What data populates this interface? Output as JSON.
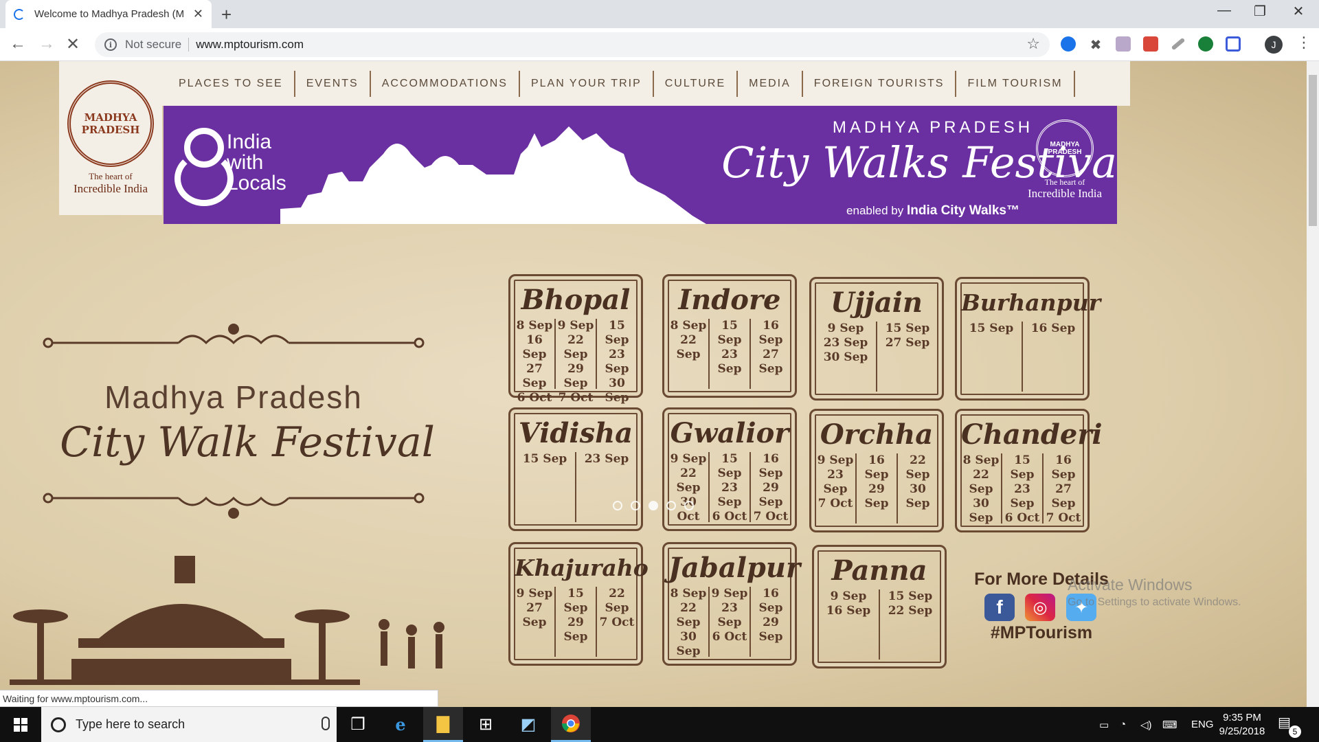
{
  "browser": {
    "tab_title": "Welcome to Madhya Pradesh (M",
    "security_label": "Not secure",
    "url": "www.mptourism.com",
    "profile_initial": "J",
    "status_text": "Waiting for www.mptourism.com..."
  },
  "site": {
    "logo": {
      "seal_text": "MADHYA PRADESH",
      "tagline_top": "The heart of",
      "tagline_bottom": "Incredible India"
    },
    "nav": [
      "PLACES TO SEE",
      "EVENTS",
      "ACCOMMODATIONS",
      "PLAN YOUR TRIP",
      "CULTURE",
      "MEDIA",
      "FOREIGN TOURISTS",
      "FILM TOURISM"
    ],
    "banner": {
      "brand_line1": "India",
      "brand_line2": "with",
      "brand_line3": "Locals",
      "state": "MADHYA PRADESH",
      "title": "City Walks Festival",
      "sub_prefix": "enabled by",
      "sub_brand": "India City Walks™",
      "seal_tag1": "The heart of",
      "seal_tag2": "Incredible India",
      "color": "#6a2fa0"
    },
    "poster": {
      "state": "Madhya Pradesh",
      "title": "City Walk Festival",
      "more_title": "For More Details",
      "hashtag": "#MPTourism",
      "social": [
        "facebook-icon",
        "instagram-icon",
        "twitter-icon"
      ]
    },
    "cities": [
      {
        "name": "Bhopal",
        "cols": [
          [
            "8 Sep",
            "16 Sep",
            "27 Sep",
            "6 Oct"
          ],
          [
            "9 Sep",
            "22 Sep",
            "29 Sep",
            "7 Oct"
          ],
          [
            "15 Sep",
            "23 Sep",
            "30 Sep"
          ]
        ]
      },
      {
        "name": "Indore",
        "cols": [
          [
            "8 Sep",
            "22 Sep"
          ],
          [
            "15 Sep",
            "23 Sep"
          ],
          [
            "16 Sep",
            "27 Sep"
          ]
        ]
      },
      {
        "name": "Ujjain",
        "cols": [
          [
            "9 Sep",
            "23 Sep",
            "30 Sep"
          ],
          [
            "15 Sep",
            "27 Sep"
          ]
        ]
      },
      {
        "name": "Burhanpur",
        "cols": [
          [
            "15 Sep"
          ],
          [
            "16 Sep"
          ]
        ]
      },
      {
        "name": "Vidisha",
        "cols": [
          [
            "15 Sep"
          ],
          [
            "23 Sep"
          ]
        ]
      },
      {
        "name": "Gwalior",
        "cols": [
          [
            "9 Sep",
            "22 Sep",
            "30 Oct"
          ],
          [
            "15 Sep",
            "23 Sep",
            "6 Oct"
          ],
          [
            "16 Sep",
            "29 Sep",
            "7 Oct"
          ]
        ]
      },
      {
        "name": "Orchha",
        "cols": [
          [
            "9 Sep",
            "23 Sep",
            "7 Oct"
          ],
          [
            "16 Sep",
            "29 Sep"
          ],
          [
            "22 Sep",
            "30 Sep"
          ]
        ]
      },
      {
        "name": "Chanderi",
        "cols": [
          [
            "8 Sep",
            "22 Sep",
            "30 Sep"
          ],
          [
            "15 Sep",
            "23 Sep",
            "6 Oct"
          ],
          [
            "16 Sep",
            "27 Sep",
            "7 Oct"
          ]
        ]
      },
      {
        "name": "Khajuraho",
        "cols": [
          [
            "9 Sep",
            "27 Sep"
          ],
          [
            "15 Sep",
            "29 Sep"
          ],
          [
            "22 Sep",
            "7 Oct"
          ]
        ]
      },
      {
        "name": "Jabalpur",
        "cols": [
          [
            "8 Sep",
            "22 Sep",
            "30 Sep"
          ],
          [
            "9 Sep",
            "23 Sep",
            "6 Oct"
          ],
          [
            "16 Sep",
            "29 Sep"
          ]
        ]
      },
      {
        "name": "Panna",
        "cols": [
          [
            "9 Sep",
            "16 Sep"
          ],
          [
            "15 Sep",
            "22 Sep"
          ]
        ]
      }
    ],
    "carousel": {
      "count": 5,
      "active_index": 2
    }
  },
  "watermark": {
    "line1": "Activate Windows",
    "line2": "Go to Settings to activate Windows."
  },
  "taskbar": {
    "search_placeholder": "Type here to search",
    "language": "ENG",
    "time": "9:35 PM",
    "date": "9/25/2018",
    "notification_count": "5"
  }
}
